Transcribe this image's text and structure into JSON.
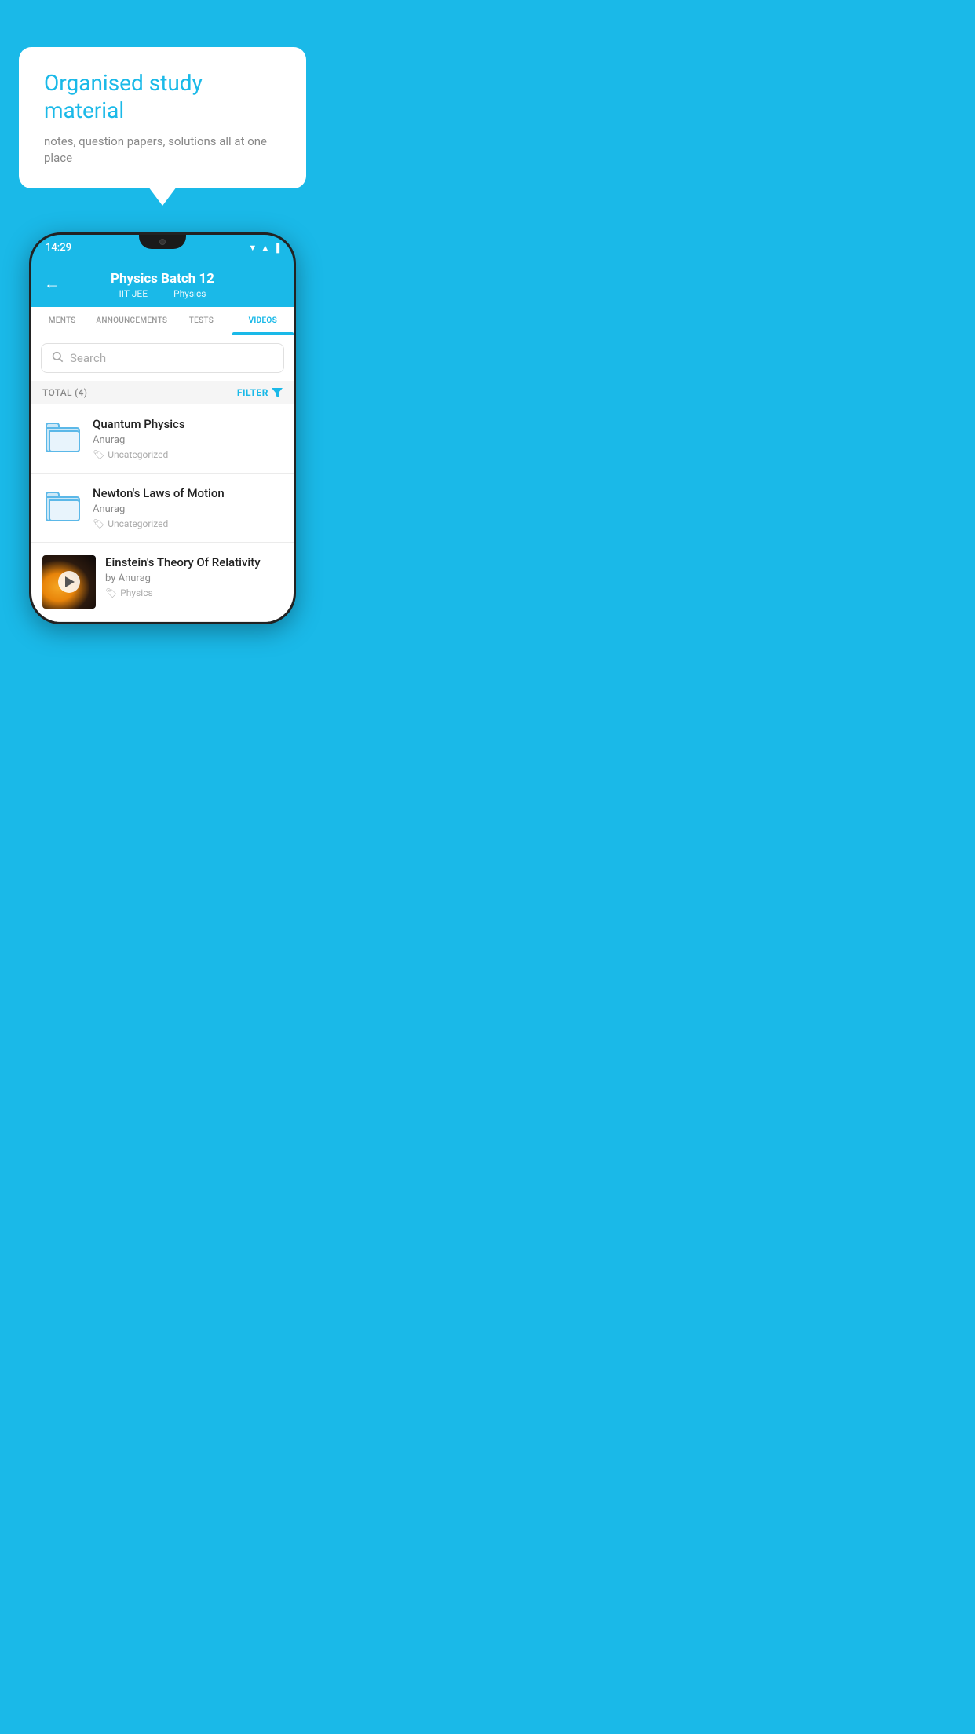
{
  "promo": {
    "title": "Organised study material",
    "subtitle": "notes, question papers, solutions all at one place"
  },
  "statusBar": {
    "time": "14:29",
    "icons": "▼◀▐"
  },
  "header": {
    "title": "Physics Batch 12",
    "subtitle1": "IIT JEE",
    "subtitle2": "Physics",
    "back_label": "←"
  },
  "tabs": [
    {
      "label": "MENTS",
      "active": false
    },
    {
      "label": "ANNOUNCEMENTS",
      "active": false
    },
    {
      "label": "TESTS",
      "active": false
    },
    {
      "label": "VIDEOS",
      "active": true
    }
  ],
  "search": {
    "placeholder": "Search"
  },
  "filter": {
    "total_label": "TOTAL (4)",
    "filter_label": "FILTER"
  },
  "videos": [
    {
      "title": "Quantum Physics",
      "author": "Anurag",
      "tag": "Uncategorized",
      "type": "folder"
    },
    {
      "title": "Newton's Laws of Motion",
      "author": "Anurag",
      "tag": "Uncategorized",
      "type": "folder"
    },
    {
      "title": "Einstein's Theory Of Relativity",
      "by": "by Anurag",
      "tag": "Physics",
      "type": "video"
    }
  ]
}
